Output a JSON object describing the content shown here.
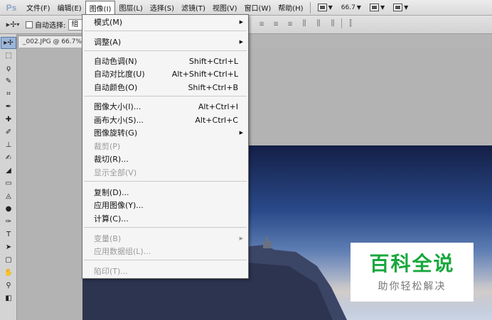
{
  "app": {
    "logo": "Ps"
  },
  "menubar": {
    "items": [
      "文件(F)",
      "编辑(E)",
      "图像(I)",
      "图层(L)",
      "选择(S)",
      "滤镜(T)",
      "视图(V)",
      "窗口(W)",
      "帮助(H)"
    ],
    "zoom": "66.7"
  },
  "options": {
    "auto_select_label": "自动选择:",
    "select_value": "组"
  },
  "document": {
    "tab_label": "_002.JPG @ 66.7%"
  },
  "image_menu": {
    "items": [
      {
        "label": "模式(M)",
        "shortcut": "",
        "submenu": true,
        "disabled": false
      },
      {
        "label": "调整(A)",
        "shortcut": "",
        "submenu": true,
        "disabled": false
      },
      {
        "label": "自动色调(N)",
        "shortcut": "Shift+Ctrl+L",
        "submenu": false,
        "disabled": false
      },
      {
        "label": "自动对比度(U)",
        "shortcut": "Alt+Shift+Ctrl+L",
        "submenu": false,
        "disabled": false
      },
      {
        "label": "自动颜色(O)",
        "shortcut": "Shift+Ctrl+B",
        "submenu": false,
        "disabled": false
      },
      {
        "label": "图像大小(I)...",
        "shortcut": "Alt+Ctrl+I",
        "submenu": false,
        "disabled": false
      },
      {
        "label": "画布大小(S)...",
        "shortcut": "Alt+Ctrl+C",
        "submenu": false,
        "disabled": false
      },
      {
        "label": "图像旋转(G)",
        "shortcut": "",
        "submenu": true,
        "disabled": false
      },
      {
        "label": "裁剪(P)",
        "shortcut": "",
        "submenu": false,
        "disabled": true
      },
      {
        "label": "裁切(R)...",
        "shortcut": "",
        "submenu": false,
        "disabled": false
      },
      {
        "label": "显示全部(V)",
        "shortcut": "",
        "submenu": false,
        "disabled": true
      },
      {
        "label": "复制(D)...",
        "shortcut": "",
        "submenu": false,
        "disabled": false
      },
      {
        "label": "应用图像(Y)...",
        "shortcut": "",
        "submenu": false,
        "disabled": false
      },
      {
        "label": "计算(C)...",
        "shortcut": "",
        "submenu": false,
        "disabled": false
      },
      {
        "label": "变量(B)",
        "shortcut": "",
        "submenu": true,
        "disabled": true
      },
      {
        "label": "应用数据组(L)...",
        "shortcut": "",
        "submenu": false,
        "disabled": true
      },
      {
        "label": "陷印(T)...",
        "shortcut": "",
        "submenu": false,
        "disabled": true
      }
    ]
  },
  "watermark": {
    "title": "百科全说",
    "subtitle": "助你轻松解决",
    "color": "#18a83d"
  }
}
